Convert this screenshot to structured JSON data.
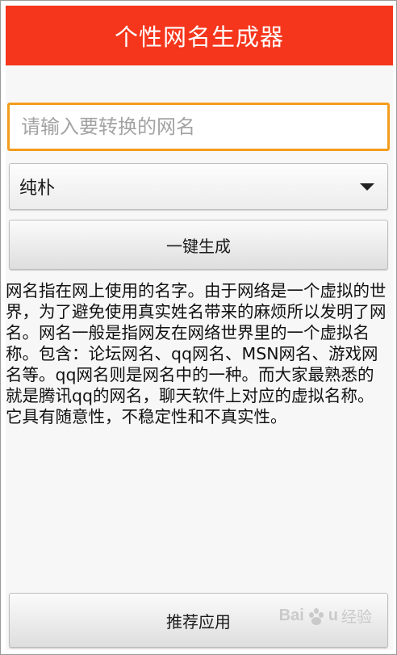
{
  "app": {
    "title": "个性网名生成器"
  },
  "input": {
    "value": "",
    "placeholder": "请输入要转换的网名"
  },
  "style_select": {
    "selected": "纯朴"
  },
  "buttons": {
    "generate_label": "一键生成",
    "recommend_label": "推荐应用"
  },
  "description": {
    "text": "网名指在网上使用的名字。由于网络是一个虚拟的世界，为了避免使用真实姓名带来的麻烦所以发明了网名。网名一般是指网友在网络世界里的一个虚拟名称。包含：论坛网名、qq网名、MSN网名、游戏网名等。qq网名则是网名中的一种。而大家最熟悉的就是腾讯qq的网名，聊天软件上对应的虚拟名称。它具有随意性，不稳定性和不真实性。"
  },
  "watermark": {
    "brand": "Bai",
    "brand_suffix": "u",
    "product": "经验"
  },
  "colors": {
    "title_bar": "#f5361c",
    "input_focus_border": "#f49c1c"
  }
}
